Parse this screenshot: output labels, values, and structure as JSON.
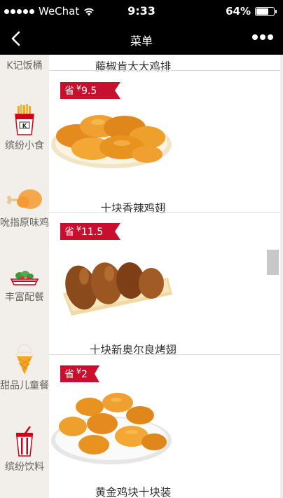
{
  "status_bar": {
    "carrier": "WeChat",
    "time": "9:33",
    "battery": "64%",
    "battery_level": 0.64
  },
  "nav": {
    "title": "菜单",
    "back_icon": "chevron-left-icon",
    "more_icon": "more-dots-icon"
  },
  "sidebar": {
    "items": [
      {
        "label": "K记饭桶",
        "icon": ""
      },
      {
        "label": "缤纷小食",
        "icon": "fries-box-icon"
      },
      {
        "label": "吮指原味鸡",
        "icon": "chicken-drumstick-icon"
      },
      {
        "label": "丰富配餐",
        "icon": "salad-bowl-icon"
      },
      {
        "label": "甜品儿童餐",
        "icon": "ice-cream-cone-icon"
      },
      {
        "label": "缤纷饮料",
        "icon": "drink-cup-icon"
      }
    ]
  },
  "menu": {
    "items": [
      {
        "name": "藤椒肯大大鸡排"
      },
      {
        "badge": "省",
        "currency": "¥",
        "price": "9.5",
        "name": "十块香辣鸡翅"
      },
      {
        "badge": "省",
        "currency": "¥",
        "price": "11.5",
        "name": "十块新奥尔良烤翅"
      },
      {
        "badge": "省",
        "currency": "¥",
        "price": "2",
        "name": "黄金鸡块十块装"
      }
    ]
  },
  "colors": {
    "topbar": "#000000",
    "sidebar_bg": "#f2efea",
    "badge": "#c8102e",
    "sidebar_text": "#666666"
  }
}
